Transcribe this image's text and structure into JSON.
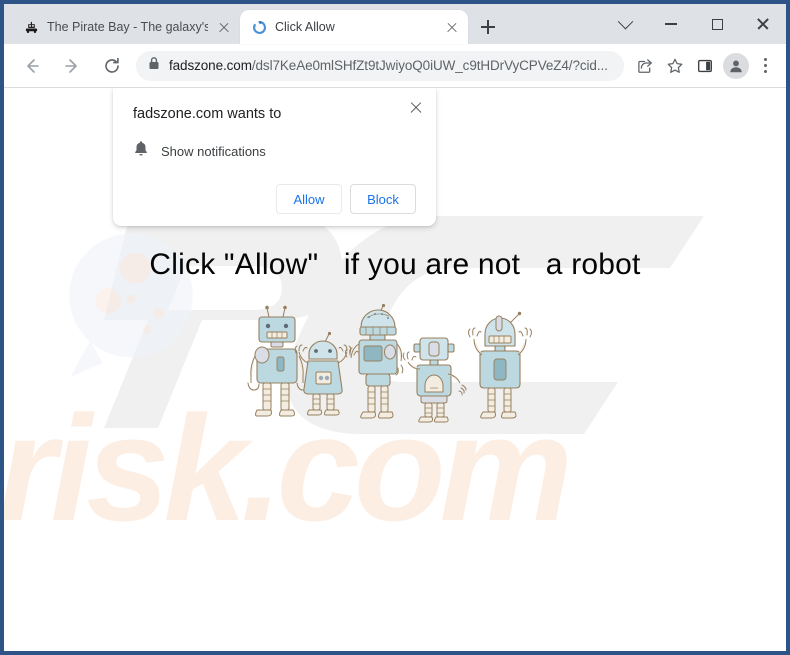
{
  "browser": {
    "tabs": [
      {
        "title": "The Pirate Bay - The galaxy's mo",
        "favicon": "pirate-ship-icon",
        "active": false
      },
      {
        "title": "Click Allow",
        "favicon": "chrome-reload-icon",
        "active": true
      }
    ],
    "new_tab_label": "+",
    "window_controls": {
      "tab_search": "chevron-down-icon",
      "minimize": "minimize-icon",
      "maximize": "maximize-icon",
      "close": "close-icon"
    },
    "toolbar": {
      "back": "back-arrow-icon",
      "forward": "forward-arrow-icon",
      "reload": "reload-icon",
      "lock": "lock-icon",
      "url_host": "fadszone.com",
      "url_path": "/dsl7KeAe0mlSHfZt9tJwiyoQ0iUW_c9tHDrVyCPVeZ4/?cid...",
      "url_full": "fadszone.com/dsl7KeAe0mlSHfZt9tJwiyoQ0iUW_c9tHDrVyCPVeZ4/?cid...",
      "share": "share-icon",
      "bookmark": "star-icon",
      "side_panel": "side-panel-icon",
      "profile": "profile-avatar-icon",
      "menu": "three-dot-menu-icon"
    }
  },
  "dialog": {
    "title": "fadszone.com wants to",
    "permission_icon": "bell-icon",
    "permission_label": "Show notifications",
    "allow_label": "Allow",
    "block_label": "Block",
    "close_icon": "close-icon"
  },
  "page": {
    "heading": "Click \"Allow\"   if you are not   a robot",
    "image_alt": "five-cartoon-robots",
    "watermark_top": "PC",
    "watermark_bottom": "risk.com"
  },
  "colors": {
    "frame_border": "#2d5387",
    "tab_strip": "#dee1e6",
    "omnibox_bg": "#f1f3f4",
    "accent_blue": "#1a73e8",
    "text_primary": "#202124",
    "text_secondary": "#5f6368",
    "watermark_gray": "#f0f0f0",
    "watermark_peach": "#fdeee4",
    "robot_body": "#b9d6de",
    "robot_outline": "#9c8164"
  }
}
